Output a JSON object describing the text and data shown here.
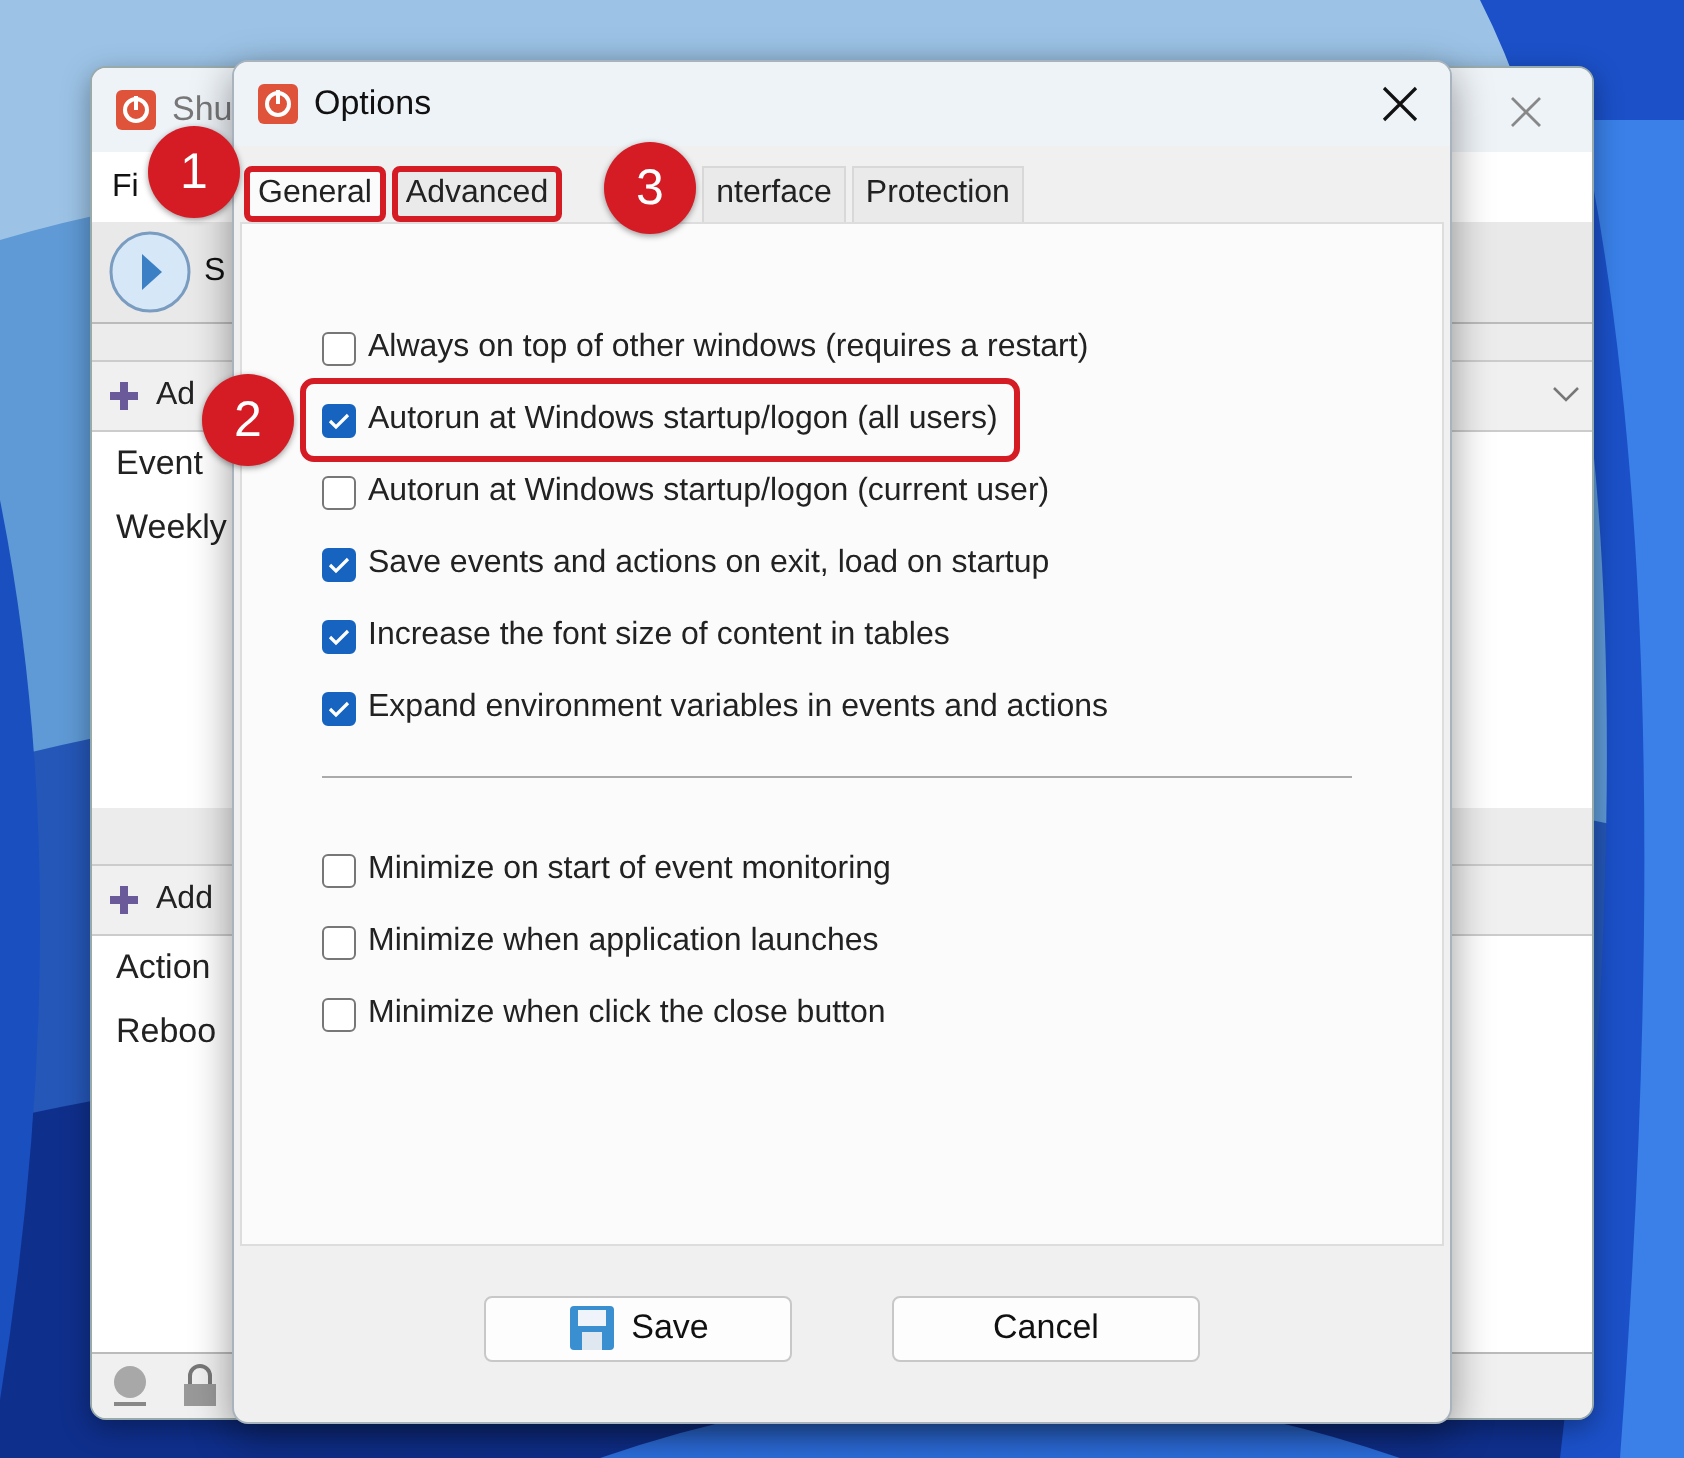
{
  "back_window": {
    "title": "Shu",
    "menu": [
      "Fi"
    ],
    "toolbar_button": "S",
    "panels": [
      {
        "header": "Ad",
        "items": [
          "Event",
          "Weekly"
        ]
      },
      {
        "header": "Add",
        "items": [
          "Action",
          "Reboo"
        ]
      }
    ]
  },
  "dialog": {
    "title": "Options",
    "tabs": [
      {
        "label": "General",
        "selected": true,
        "highlighted": true
      },
      {
        "label": "Advanced",
        "selected": false,
        "highlighted": true
      },
      {
        "label": "nterface",
        "selected": false,
        "highlighted": false
      },
      {
        "label": "Protection",
        "selected": false,
        "highlighted": false
      }
    ],
    "option_groups": [
      [
        {
          "label": "Always on top of other windows (requires a restart)",
          "checked": false,
          "highlighted": false
        },
        {
          "label": "Autorun at Windows startup/logon (all users)",
          "checked": true,
          "highlighted": true
        },
        {
          "label": "Autorun at Windows startup/logon (current user)",
          "checked": false,
          "highlighted": false
        },
        {
          "label": "Save events and actions on exit, load on startup",
          "checked": true,
          "highlighted": false
        },
        {
          "label": "Increase the font size of content in tables",
          "checked": true,
          "highlighted": false
        },
        {
          "label": "Expand environment variables in events and actions",
          "checked": true,
          "highlighted": false
        }
      ],
      [
        {
          "label": "Minimize on start of event monitoring",
          "checked": false,
          "highlighted": false
        },
        {
          "label": "Minimize when application launches",
          "checked": false,
          "highlighted": false
        },
        {
          "label": "Minimize when click the close button",
          "checked": false,
          "highlighted": false
        }
      ]
    ],
    "buttons": [
      {
        "label": "Save",
        "kind": "save"
      },
      {
        "label": "Cancel",
        "kind": "plain"
      }
    ]
  },
  "callouts": [
    "1",
    "2",
    "3"
  ]
}
